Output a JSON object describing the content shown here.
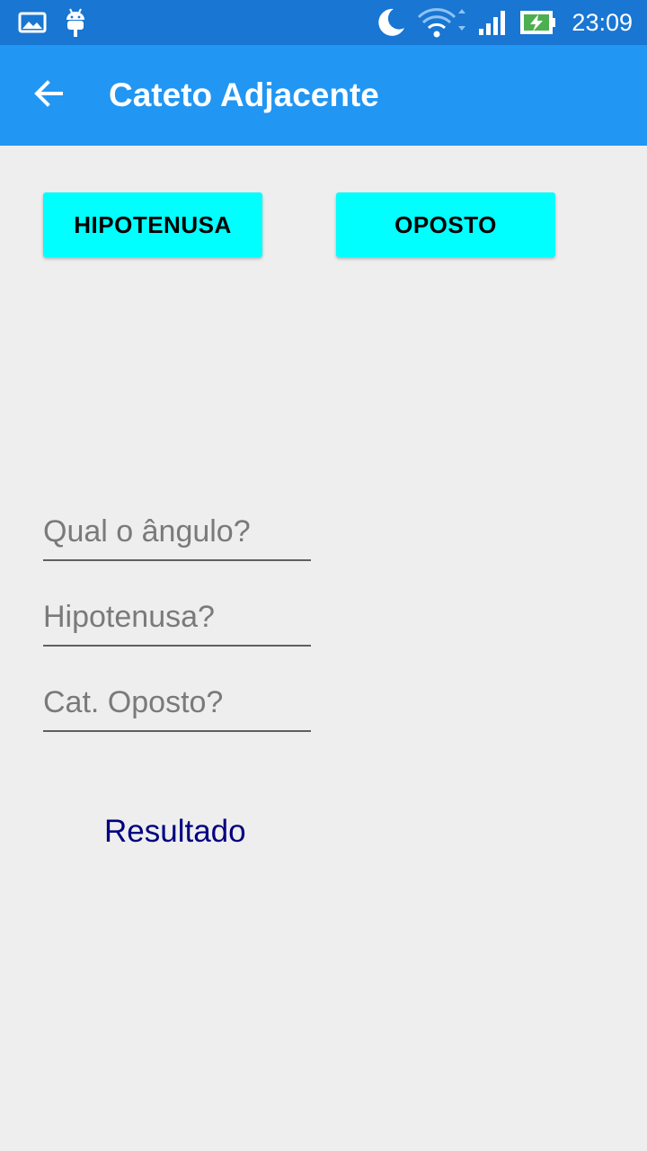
{
  "status_bar": {
    "time": "23:09",
    "icons": [
      "gallery-icon",
      "android-debug-icon",
      "moon-icon",
      "wifi-icon",
      "signal-icon",
      "battery-charging-icon"
    ],
    "background": "#1976d2"
  },
  "app_bar": {
    "title": "Cateto Adjacente",
    "back_icon": "back-arrow-icon",
    "background": "#2196f3"
  },
  "buttons": {
    "hipotenusa_label": "HIPOTENUSA",
    "oposto_label": "OPOSTO",
    "color": "#00ffff"
  },
  "form": {
    "angle_placeholder": "Qual o ângulo?",
    "hypotenuse_placeholder": "Hipotenusa?",
    "opposite_placeholder": "Cat. Oposto?"
  },
  "result": {
    "label": "Resultado",
    "color": "#000080"
  }
}
